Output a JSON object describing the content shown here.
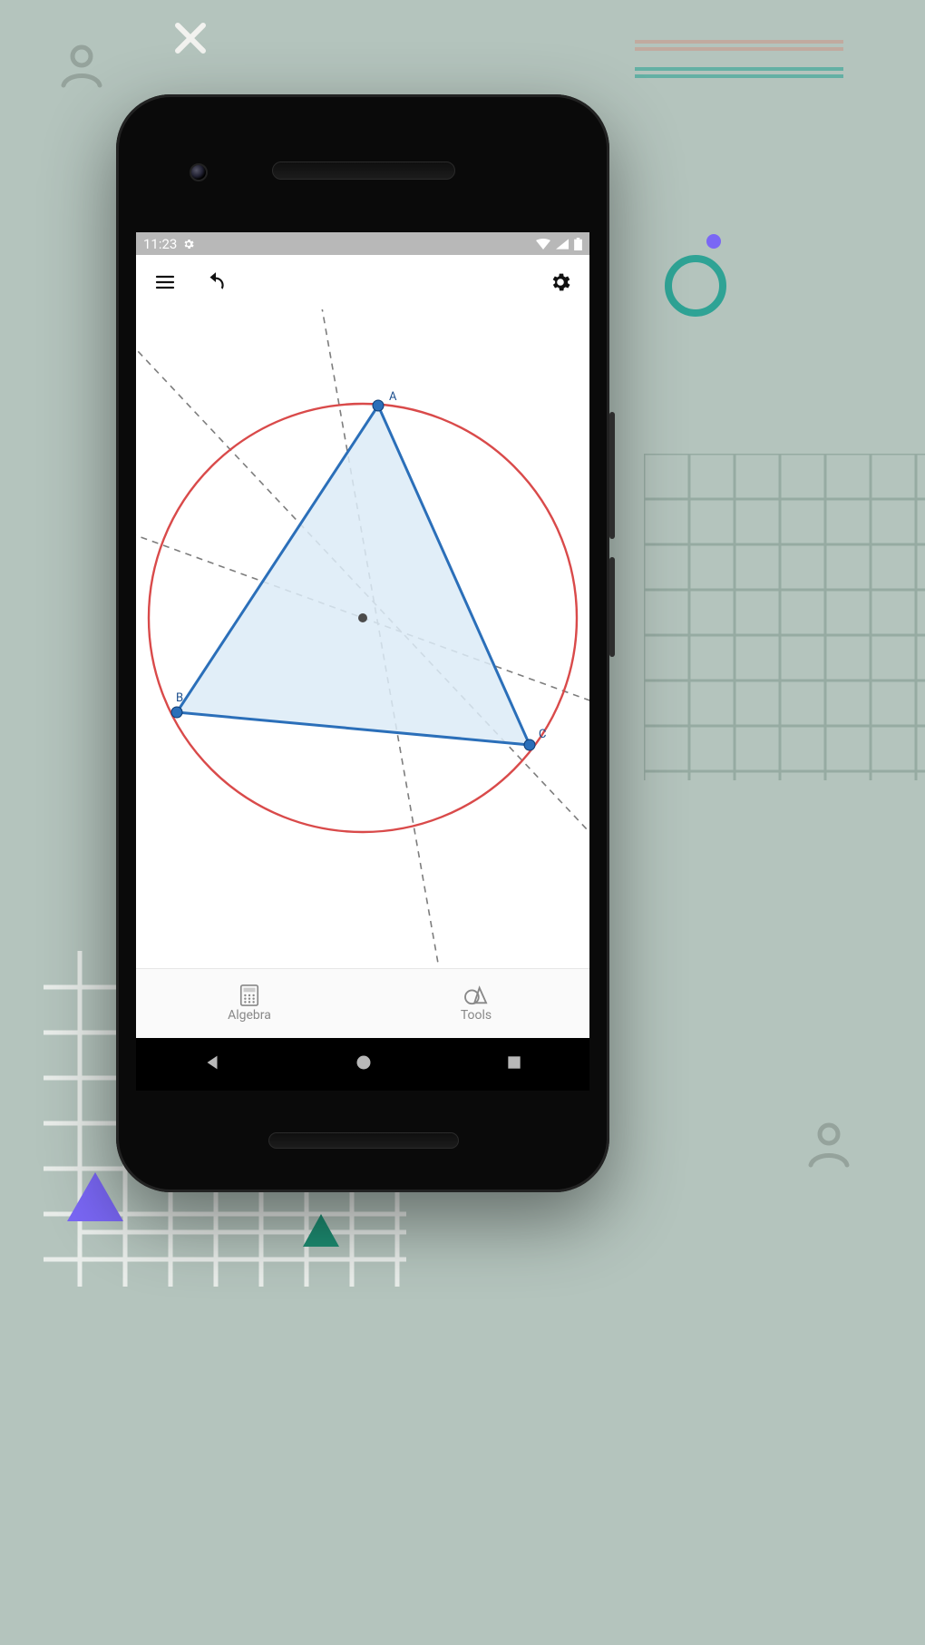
{
  "statusbar": {
    "time": "11:23"
  },
  "appbar": {
    "menu_icon": "menu-icon",
    "undo_icon": "undo-icon",
    "settings_icon": "gear-icon"
  },
  "geometry": {
    "points": {
      "A": "A",
      "B": "B",
      "C": "C"
    },
    "circle": {
      "stroke": "#d94a4a"
    },
    "triangle": {
      "stroke": "#2b6fb9",
      "fill": "#dcebf7"
    },
    "bisector": {
      "stroke": "#7d7d7d"
    },
    "point_fill": "#2b6fb9",
    "center_fill": "#4b4b4b"
  },
  "bottombar": {
    "algebra": {
      "label": "Algebra"
    },
    "tools": {
      "label": "Tools"
    }
  },
  "navbar": {
    "back_icon": "back-icon",
    "home_icon": "home-icon",
    "recent_icon": "recent-icon"
  }
}
